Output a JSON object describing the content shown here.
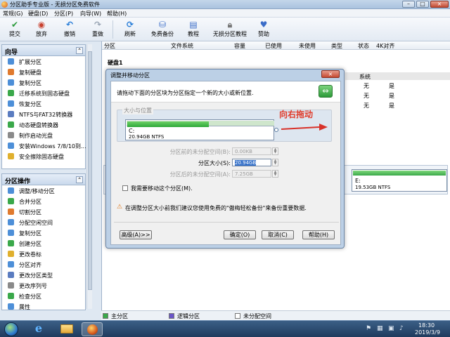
{
  "window": {
    "title": "分区助手专业版 - 无损分区免费软件",
    "controls": [
      "–",
      "□",
      "×"
    ]
  },
  "menu": [
    "常规(G)",
    "硬盘(D)",
    "分区(P)",
    "向导(W)",
    "帮助(H)"
  ],
  "toolbar": [
    {
      "label": "提交",
      "icon": "check-icon",
      "color": "#2a9a3a"
    },
    {
      "label": "放弃",
      "icon": "discard-icon",
      "color": "#c8412e"
    },
    {
      "label": "撤销",
      "icon": "undo-icon",
      "color": "#2a7ed8"
    },
    {
      "label": "重做",
      "icon": "redo-icon",
      "color": "#9aa6b5"
    },
    {
      "label": "刷新",
      "icon": "refresh-icon",
      "color": "#2a7ed8"
    },
    {
      "label": "免费备份",
      "icon": "backup-icon",
      "color": "#3a6cc8"
    },
    {
      "label": "教程",
      "icon": "tutorial-icon",
      "color": "#3a6cc8"
    },
    {
      "label": "无损分区教程",
      "icon": "lock-icon",
      "color": "#777777"
    },
    {
      "label": "赞助",
      "icon": "heart-icon",
      "color": "#3a6cc8"
    }
  ],
  "wizard": {
    "title": "向导",
    "items": [
      {
        "label": "扩展分区",
        "color": "#4d8fd8"
      },
      {
        "label": "复制硬盘",
        "color": "#e07a2e"
      },
      {
        "label": "复制分区",
        "color": "#4d8fd8"
      },
      {
        "label": "迁移系统到固态硬盘",
        "color": "#3aa84a"
      },
      {
        "label": "恢复分区",
        "color": "#4d8fd8"
      },
      {
        "label": "NTFS与FAT32转换器",
        "color": "#5a7cc0"
      },
      {
        "label": "动态硬盘转换器",
        "color": "#3aa84a"
      },
      {
        "label": "制作启动光盘",
        "color": "#8a8a8a"
      },
      {
        "label": "安装Windows 7/8/10到...",
        "color": "#4d8fd8"
      },
      {
        "label": "安全擦除固态硬盘",
        "color": "#e0b02e"
      }
    ]
  },
  "partition_ops": {
    "title": "分区操作",
    "items": [
      {
        "label": "调整/移动分区",
        "color": "#4d8fd8"
      },
      {
        "label": "合并分区",
        "color": "#3aa84a"
      },
      {
        "label": "切割分区",
        "color": "#e07a2e"
      },
      {
        "label": "分配空闲空间",
        "color": "#4d8fd8"
      },
      {
        "label": "复制分区",
        "color": "#4d8fd8"
      },
      {
        "label": "创建分区",
        "color": "#3aa84a"
      },
      {
        "label": "更改卷标",
        "color": "#e0b02e"
      },
      {
        "label": "分区对齐",
        "color": "#4d8fd8"
      },
      {
        "label": "更改分区类型",
        "color": "#5a7cc0"
      },
      {
        "label": "更改序列号",
        "color": "#8a8a8a"
      },
      {
        "label": "检查分区",
        "color": "#3aa84a"
      },
      {
        "label": "属性",
        "color": "#4d8fd8"
      }
    ]
  },
  "columns": [
    "分区",
    "文件系统",
    "容量",
    "已使用",
    "未使用",
    "类型",
    "状态",
    "4K对齐"
  ],
  "disk": {
    "label": "硬盘1"
  },
  "partition_rows": [
    {
      "status": "系统",
      "align": ""
    },
    {
      "status": "无",
      "align": "是"
    },
    {
      "status": "无",
      "align": "是"
    },
    {
      "status": "无",
      "align": "是"
    }
  ],
  "diskmap_right": {
    "name": "E:",
    "size": "19.53GB NTFS"
  },
  "legend": [
    {
      "label": "主分区",
      "color": "#3aa84a"
    },
    {
      "label": "逻辑分区",
      "color": "#6a55c8"
    },
    {
      "label": "未分配空间",
      "color": "#ffffff"
    }
  ],
  "dialog": {
    "title": "调整并移动分区",
    "close": "×",
    "instruction": "请拖动下面的分区块为分区指定一个新的大小或新位置.",
    "group_label": "大小与位置",
    "partition": {
      "name": "C:",
      "size": "20.94GB NTFS",
      "used_fraction": 0.55
    },
    "annotation": "向右拖动",
    "fields": [
      {
        "label": "分区前的未分配空间(B):",
        "value": "0.00KB",
        "enabled": false
      },
      {
        "label": "分区大小(S):",
        "value": "20.94GB",
        "enabled": true
      },
      {
        "label": "分区后的未分配空间(A):",
        "value": "7.25GB",
        "enabled": false
      }
    ],
    "checkbox": "我需要移动这个分区(M).",
    "warning": "在调整分区大小前我们建议您使用免费的\"傲梅轻松备份\"来备份重要数据.",
    "buttons": {
      "advanced": "高级(A)>>",
      "ok": "确定(O)",
      "cancel": "取消(C)",
      "help": "帮助(H)"
    }
  },
  "taskbar": {
    "time": "18:30",
    "date": "2019/3/9"
  }
}
